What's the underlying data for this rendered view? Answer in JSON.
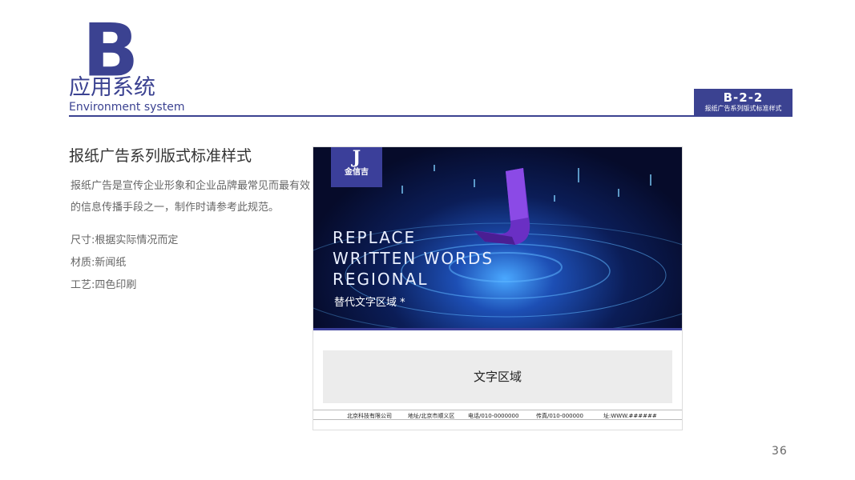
{
  "header": {
    "big_letter": "B",
    "title_cn": "应用系统",
    "title_en": "Environment system",
    "code": "B-2-2",
    "code_subtitle": "报纸广告系列版式标准样式"
  },
  "section": {
    "title": "报纸广告系列版式标准样式",
    "description": "报纸广告是宣传企业形象和企业品牌最常见而最有效的信息传播手段之一，制作时请参考此规范。",
    "specs": [
      "尺寸:根据实际情况而定",
      "材质:新闻纸",
      "工艺:四色印刷"
    ]
  },
  "ad": {
    "logo_mark": "J",
    "logo_name": "金信吉",
    "headline_lines": [
      "REPLACE",
      "WRITTEN WORDS",
      "REGIONAL"
    ],
    "subtitle": "替代文字区域 *",
    "text_area": "文字区域",
    "footer": [
      "北京科技有限公司",
      "地址/北京市顺义区",
      "电话/010-0000000",
      "传真/010-000000",
      "址:WWW.######"
    ]
  },
  "page_number": "36",
  "colors": {
    "brand": "#3b4291",
    "panel": "#ececec"
  }
}
